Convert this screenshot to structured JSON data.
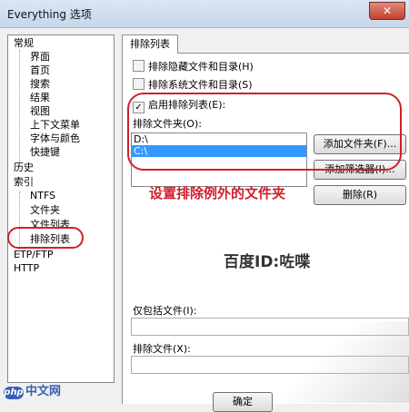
{
  "window": {
    "title": "Everything 选项",
    "close_glyph": "✕"
  },
  "tree": {
    "items": [
      {
        "label": "常规"
      },
      {
        "label": "界面"
      },
      {
        "label": "首页"
      },
      {
        "label": "搜索"
      },
      {
        "label": "结果"
      },
      {
        "label": "视图"
      },
      {
        "label": "上下文菜单"
      },
      {
        "label": "字体与颜色"
      },
      {
        "label": "快捷键"
      },
      {
        "label": "历史"
      },
      {
        "label": "索引"
      },
      {
        "label": "NTFS"
      },
      {
        "label": "文件夹"
      },
      {
        "label": "文件列表"
      },
      {
        "label": "排除列表"
      },
      {
        "label": "ETP/FTP"
      },
      {
        "label": "HTTP"
      }
    ]
  },
  "tab": {
    "label": "排除列表"
  },
  "options": {
    "exclude_hidden": {
      "label": "排除隐藏文件和目录(H)",
      "checked": false
    },
    "exclude_system": {
      "label": "排除系统文件和目录(S)",
      "checked": false
    },
    "enable_exclude": {
      "label": "启用排除列表(E):",
      "checked": true,
      "check_glyph": "✓"
    }
  },
  "exclude_folders": {
    "label": "排除文件夹(O):",
    "items": [
      "D:\\",
      "C:\\"
    ],
    "selected_index": 1
  },
  "buttons": {
    "add_folder": "添加文件夹(F)...",
    "add_filter": "添加筛选器(I)...",
    "delete": "删除(R)",
    "ok": "确定"
  },
  "include_only": {
    "label": "仅包括文件(I):",
    "value": ""
  },
  "exclude_files": {
    "label": "排除文件(X):",
    "value": ""
  },
  "annotations": {
    "note": "设置排除例外的文件夹",
    "credit": "百度ID:咗喋"
  },
  "watermark": {
    "logo": "php",
    "text": "中文网"
  },
  "colors": {
    "annotation_red": "#d21e2a",
    "selection_blue": "#3399ff"
  }
}
